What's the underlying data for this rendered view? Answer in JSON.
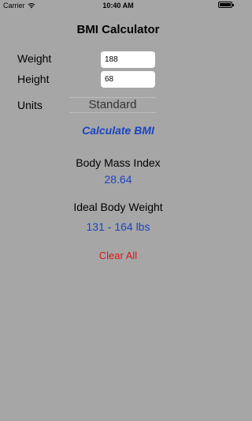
{
  "status_bar": {
    "carrier": "Carrier",
    "time": "10:40 AM"
  },
  "title": "BMI Calculator",
  "form": {
    "weight_label": "Weight",
    "weight_value": "188",
    "height_label": "Height",
    "height_value": "68",
    "units_label": "Units",
    "units_selected": "Standard"
  },
  "calculate_label": "Calculate BMI",
  "bmi": {
    "label": "Body Mass Index",
    "value": "28.64"
  },
  "ideal_weight": {
    "label": "Ideal Body Weight",
    "value": "131 - 164 lbs"
  },
  "clear_label": "Clear All",
  "colors": {
    "background": "#a6a6a6",
    "accent_blue": "#1a45c2",
    "clear_red": "#e01515"
  }
}
